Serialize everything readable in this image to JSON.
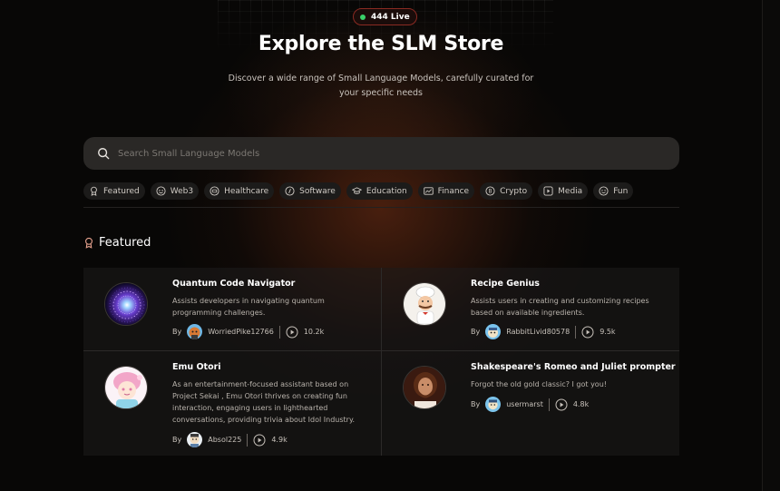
{
  "live_badge": {
    "text": "444 Live",
    "dot_color": "#3ad06a"
  },
  "title": "Explore the SLM Store",
  "subtitle": "Discover a wide range of Small Language Models, carefully curated for your specific needs",
  "search": {
    "placeholder": "Search Small Language Models",
    "icon": "search-icon"
  },
  "categories": [
    {
      "label": "Featured",
      "icon": "award-icon"
    },
    {
      "label": "Web3",
      "icon": "web3-icon"
    },
    {
      "label": "Healthcare",
      "icon": "healthcare-icon"
    },
    {
      "label": "Software",
      "icon": "software-icon"
    },
    {
      "label": "Education",
      "icon": "graduation-cap-icon"
    },
    {
      "label": "Finance",
      "icon": "finance-icon"
    },
    {
      "label": "Crypto",
      "icon": "crypto-icon"
    },
    {
      "label": "Media",
      "icon": "media-icon"
    },
    {
      "label": "Fun",
      "icon": "smile-icon"
    }
  ],
  "section": {
    "title": "Featured",
    "icon": "award-icon"
  },
  "cards": [
    {
      "title": "Quantum Code Navigator",
      "description": "Assists developers in navigating quantum programming challenges.",
      "by": "By",
      "author": "WorriedPike12766",
      "plays": "10.2k"
    },
    {
      "title": "Recipe Genius",
      "description": "Assists users in creating and customizing recipes based on available ingredients.",
      "by": "By",
      "author": "RabbitLivid80578",
      "plays": "9.5k"
    },
    {
      "title": "Emu Otori",
      "description": "As an entertainment-focused assistant based on Project Sekai , Emu Otori thrives on creating fun interaction, engaging users in lighthearted conversations, providing trivia about Idol Industry.",
      "by": "By",
      "author": "Absol225",
      "plays": "4.9k"
    },
    {
      "title": "Shakespeare's Romeo and Juliet prompter",
      "description": "Forgot the old gold classic? I got you!",
      "by": "By",
      "author": "usermarst",
      "plays": "4.8k"
    }
  ],
  "colors": {
    "accent_border": "#8a2a22",
    "background": "#080706",
    "chip_bg": "#1c1b1a",
    "search_bg": "#2a2826"
  }
}
